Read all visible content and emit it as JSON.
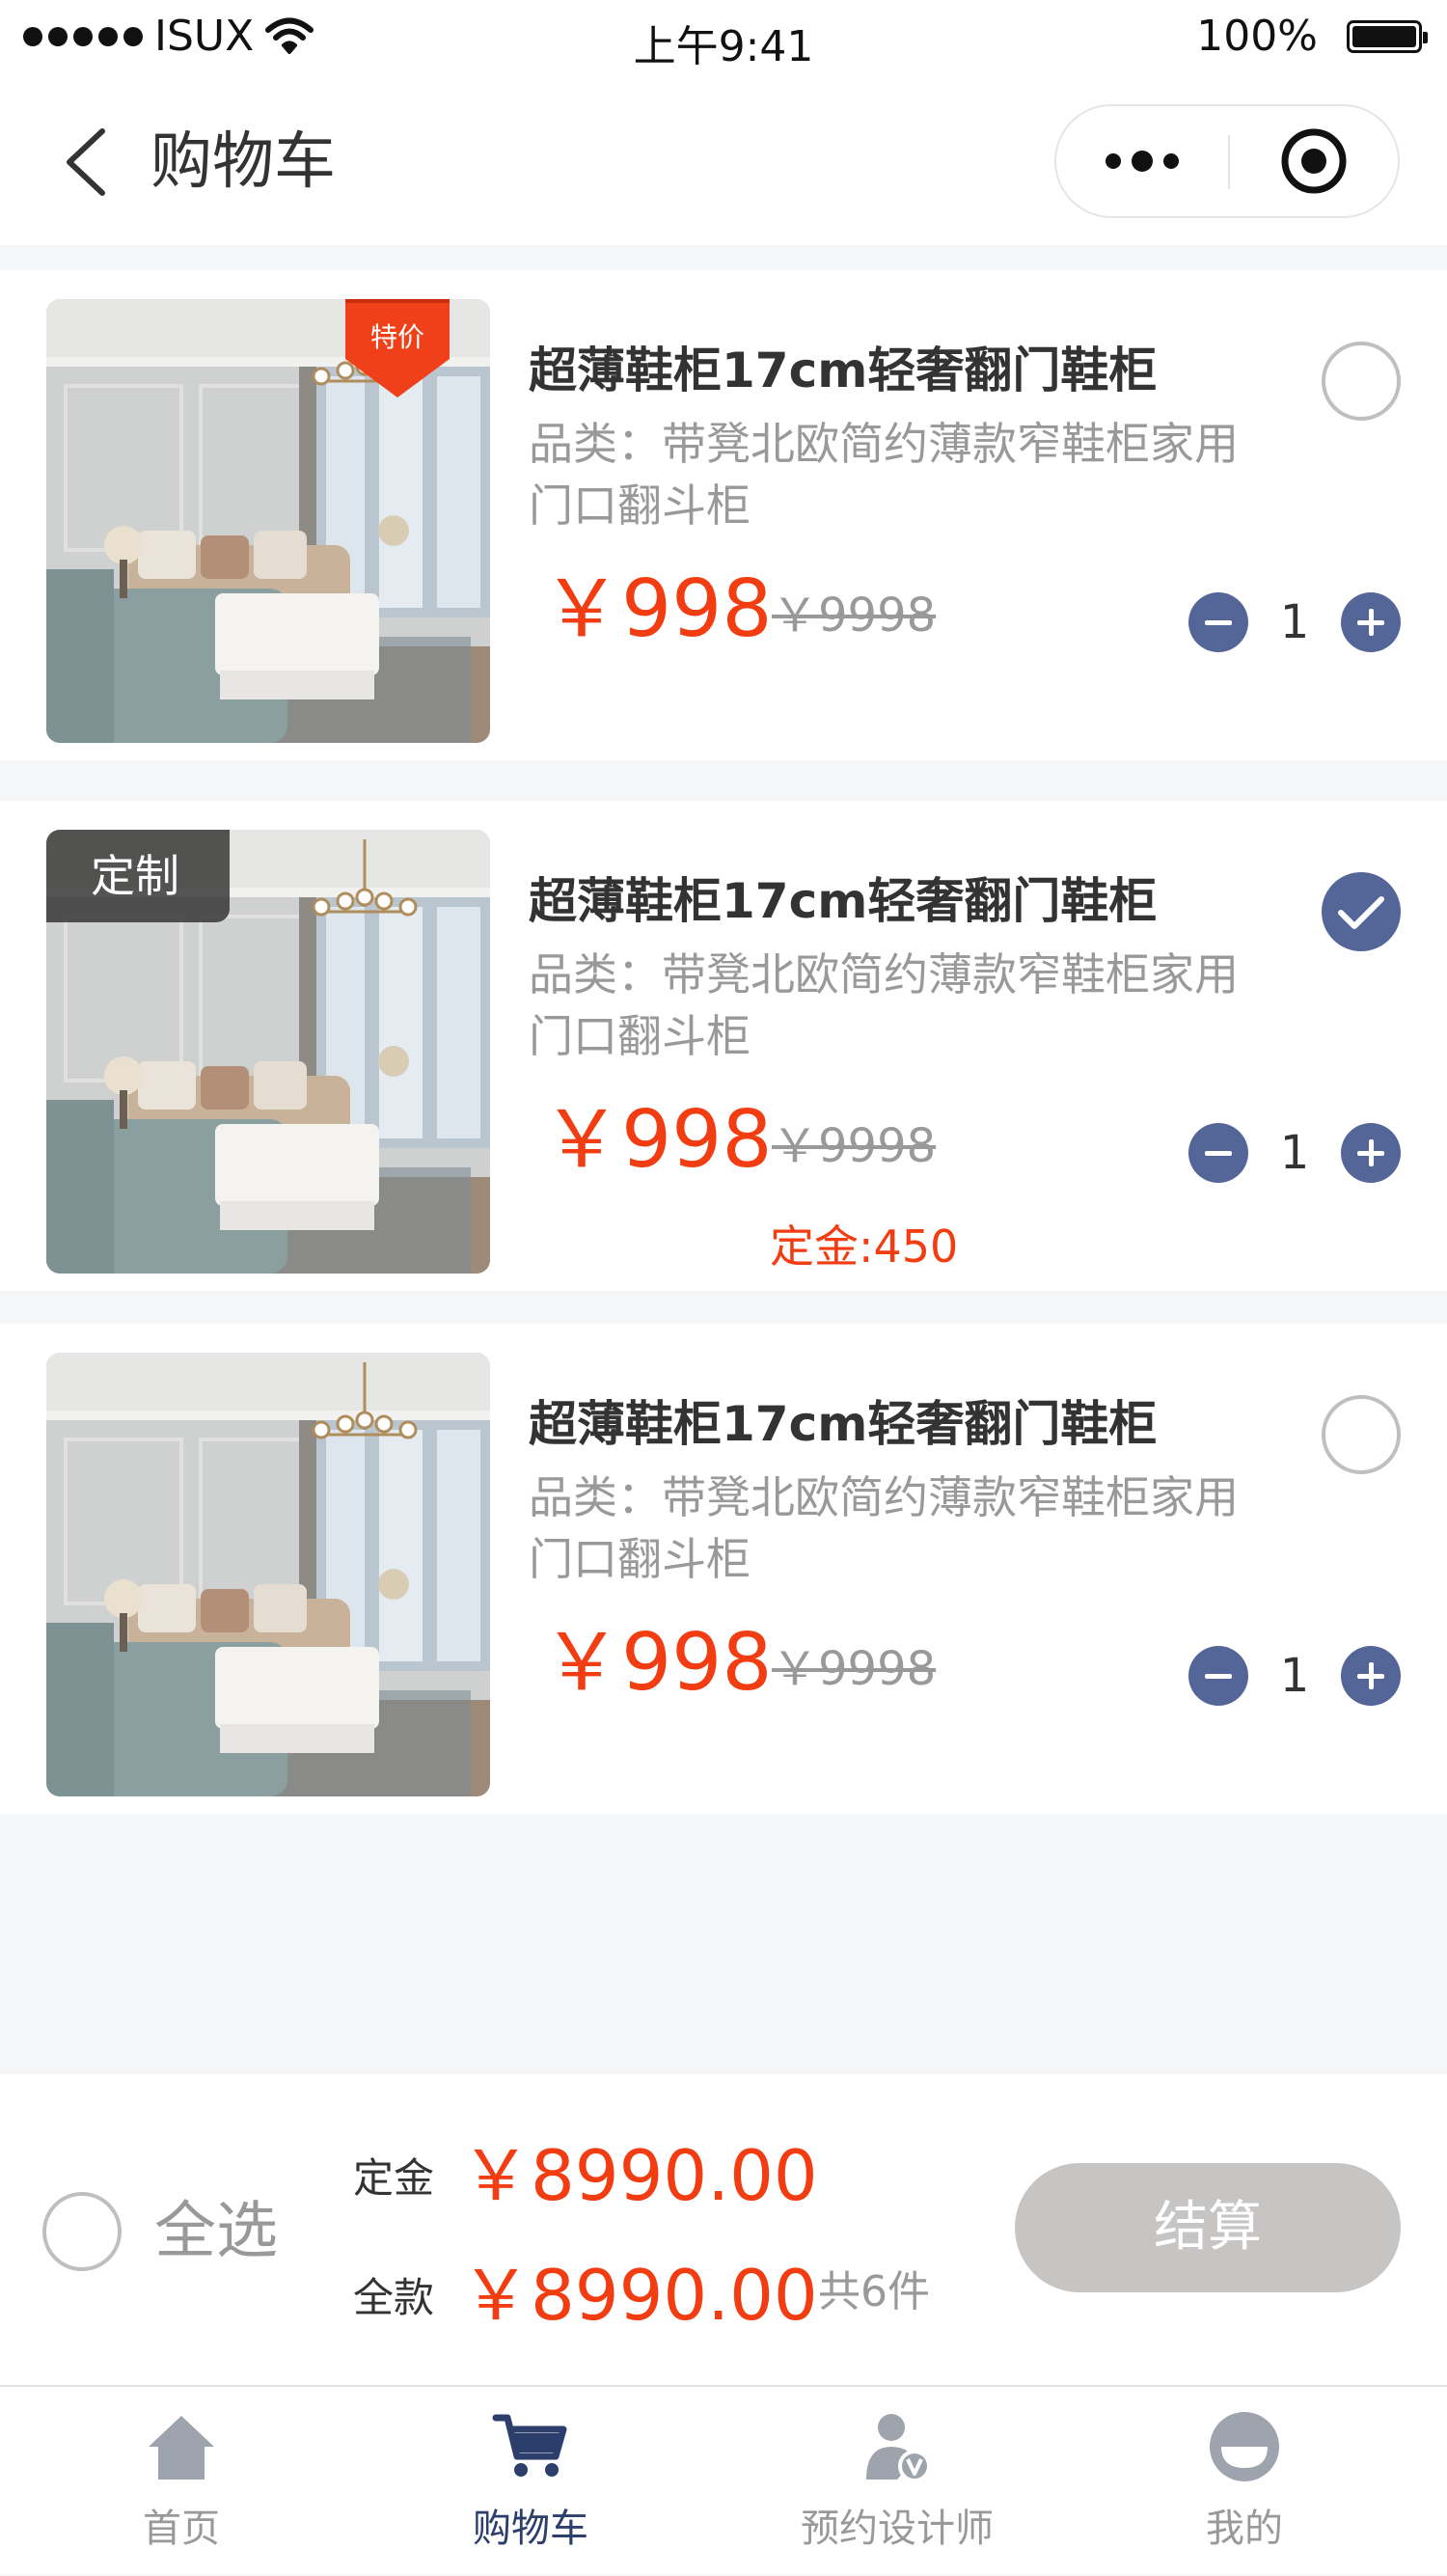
{
  "status_bar": {
    "carrier": "ISUX",
    "time": "上午9:41",
    "battery": "100%"
  },
  "nav": {
    "title": "购物车"
  },
  "items": [
    {
      "tag": "特价",
      "title": "超薄鞋柜17cm轻奢翻门鞋柜",
      "desc": "品类：带凳北欧简约薄款窄鞋柜家用门口翻斗柜",
      "price": "￥998",
      "old_price": "￥9998",
      "qty": "1",
      "selected": false
    },
    {
      "tag": "定制",
      "title": "超薄鞋柜17cm轻奢翻门鞋柜",
      "desc": "品类：带凳北欧简约薄款窄鞋柜家用门口翻斗柜",
      "price": "￥998",
      "old_price": "￥9998",
      "deposit": "定金:450",
      "qty": "1",
      "selected": true
    },
    {
      "title": "超薄鞋柜17cm轻奢翻门鞋柜",
      "desc": "品类：带凳北欧简约薄款窄鞋柜家用门口翻斗柜",
      "price": "￥998",
      "old_price": "￥9998",
      "qty": "1",
      "selected": false
    }
  ],
  "checkout": {
    "select_all": "全选",
    "deposit_label": "定金",
    "deposit_amount": "￥8990.00",
    "total_label": "全款",
    "total_amount": "￥8990.00",
    "count": "共6件",
    "pay_button": "结算"
  },
  "tabbar": [
    {
      "label": "首页",
      "icon": "home-icon"
    },
    {
      "label": "购物车",
      "icon": "cart-icon",
      "active": true
    },
    {
      "label": "预约设计师",
      "icon": "designer-icon"
    },
    {
      "label": "我的",
      "icon": "profile-icon"
    }
  ],
  "colors": {
    "accent": "#546597",
    "price": "#f23d12",
    "tab_active": "#2c3e6b",
    "pay_disabled": "#c7c4c4"
  }
}
